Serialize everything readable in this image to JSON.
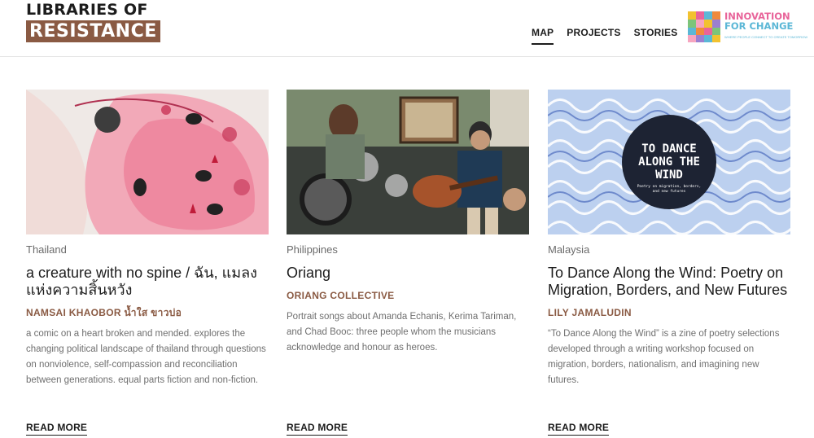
{
  "logo": {
    "line1": "LIBRARIES OF",
    "line2": "RESISTANCE"
  },
  "nav": {
    "items": [
      {
        "label": "MAP",
        "active": true
      },
      {
        "label": "PROJECTS",
        "active": false
      },
      {
        "label": "STORIES",
        "active": false
      }
    ]
  },
  "partner": {
    "line1": "INNOVATION",
    "line2": "FOR CHANGE",
    "tagline": "WHERE PEOPLE CONNECT TO CREATE TOMORROW"
  },
  "cards": [
    {
      "country": "Thailand",
      "title": "a creature with no spine / ฉัน, แมลง แห่งความสิ้นหวัง",
      "author": "NAMSAI KHAOBOR น้ำใส ขาวบ่อ",
      "description": "a comic on a heart broken and mended. explores the changing political landscape of thailand through questions on nonviolence, self-compassion and reconciliation between generations. equal parts fiction and non-fiction.",
      "read_more": "READ MORE"
    },
    {
      "country": "Philippines",
      "title": "Oriang",
      "author": "ORIANG COLLECTIVE",
      "description": "Portrait songs about Amanda Echanis, Kerima Tariman, and Chad Booc: three people whom the musicians acknowledge and honour as heroes.",
      "read_more": "READ MORE"
    },
    {
      "country": "Malaysia",
      "title": "To Dance Along the Wind: Poetry on Migration, Borders, and New Futures",
      "author": "LILY JAMALUDIN",
      "description": "“To Dance Along the Wind” is a zine of poetry selections developed through a writing workshop focused on migration, borders, nationalism, and imagining new futures.",
      "read_more": "READ MORE",
      "image_text": {
        "title": "TO DANCE ALONG THE WIND",
        "subtitle": "Poetry on migration, borders, and new futures"
      }
    }
  ],
  "colors": {
    "brand_brown": "#8a5a43",
    "text_dark": "#1c1c1c",
    "text_muted": "#6f6f6f",
    "partner_pink": "#e8649a",
    "partner_blue": "#5bb7d6"
  }
}
